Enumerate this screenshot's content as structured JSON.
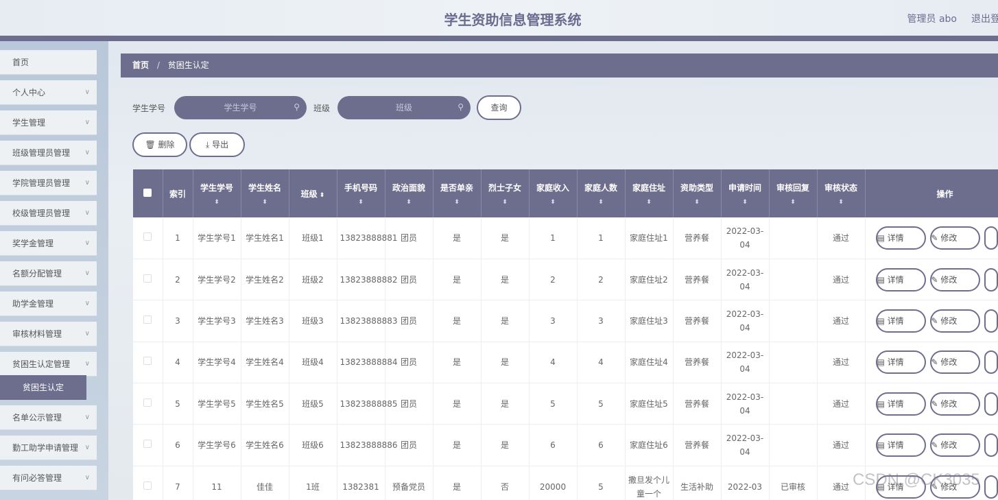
{
  "header": {
    "title": "学生资助信息管理系统",
    "user": "管理员 abo",
    "logout": "退出登"
  },
  "sidebar": {
    "items": [
      {
        "label": "首页"
      },
      {
        "label": "个人中心"
      },
      {
        "label": "学生管理"
      },
      {
        "label": "班级管理员管理"
      },
      {
        "label": "学院管理员管理"
      },
      {
        "label": "校级管理员管理"
      },
      {
        "label": "奖学金管理"
      },
      {
        "label": "名额分配管理"
      },
      {
        "label": "助学金管理"
      },
      {
        "label": "审核材料管理"
      },
      {
        "label": "贫困生认定管理"
      },
      {
        "label": "名单公示管理"
      },
      {
        "label": "勤工助学申请管理"
      },
      {
        "label": "有问必答管理"
      }
    ],
    "active_sub": "贫困生认定"
  },
  "breadcrumb": {
    "home": "首页",
    "sep": "/",
    "current": "贫困生认定"
  },
  "search": {
    "student_no_label": "学生学号",
    "student_no_placeholder": "学生学号",
    "class_label": "班级",
    "class_placeholder": "班级",
    "query_button": "查询"
  },
  "toolbar": {
    "delete": "删除",
    "export": "导出"
  },
  "table": {
    "headers": [
      "索引",
      "学生学号",
      "学生姓名",
      "班级",
      "手机号码",
      "政治面貌",
      "是否单亲",
      "烈士子女",
      "家庭收入",
      "家庭人数",
      "家庭住址",
      "资助类型",
      "申请时间",
      "审核回复",
      "审核状态",
      "操作"
    ],
    "rows": [
      [
        "1",
        "学生学号1",
        "学生姓名1",
        "班级1",
        "13823888881",
        "团员",
        "是",
        "是",
        "1",
        "1",
        "家庭住址1",
        "营养餐",
        "2022-03-04",
        "",
        "通过"
      ],
      [
        "2",
        "学生学号2",
        "学生姓名2",
        "班级2",
        "13823888882",
        "团员",
        "是",
        "是",
        "2",
        "2",
        "家庭住址2",
        "营养餐",
        "2022-03-04",
        "",
        "通过"
      ],
      [
        "3",
        "学生学号3",
        "学生姓名3",
        "班级3",
        "13823888883",
        "团员",
        "是",
        "是",
        "3",
        "3",
        "家庭住址3",
        "营养餐",
        "2022-03-04",
        "",
        "通过"
      ],
      [
        "4",
        "学生学号4",
        "学生姓名4",
        "班级4",
        "13823888884",
        "团员",
        "是",
        "是",
        "4",
        "4",
        "家庭住址4",
        "营养餐",
        "2022-03-04",
        "",
        "通过"
      ],
      [
        "5",
        "学生学号5",
        "学生姓名5",
        "班级5",
        "13823888885",
        "团员",
        "是",
        "是",
        "5",
        "5",
        "家庭住址5",
        "营养餐",
        "2022-03-04",
        "",
        "通过"
      ],
      [
        "6",
        "学生学号6",
        "学生姓名6",
        "班级6",
        "13823888886",
        "团员",
        "是",
        "是",
        "6",
        "6",
        "家庭住址6",
        "营养餐",
        "2022-03-04",
        "",
        "通过"
      ],
      [
        "7",
        "11",
        "佳佳",
        "1班",
        "1382381",
        "预备党员",
        "是",
        "否",
        "20000",
        "5",
        "撒旦发个儿童一个",
        "生活补助",
        "2022-03",
        "已审核",
        "通过"
      ]
    ],
    "op_detail": "详情",
    "op_edit": "修改"
  },
  "watermark": "CSDN @CK3035"
}
